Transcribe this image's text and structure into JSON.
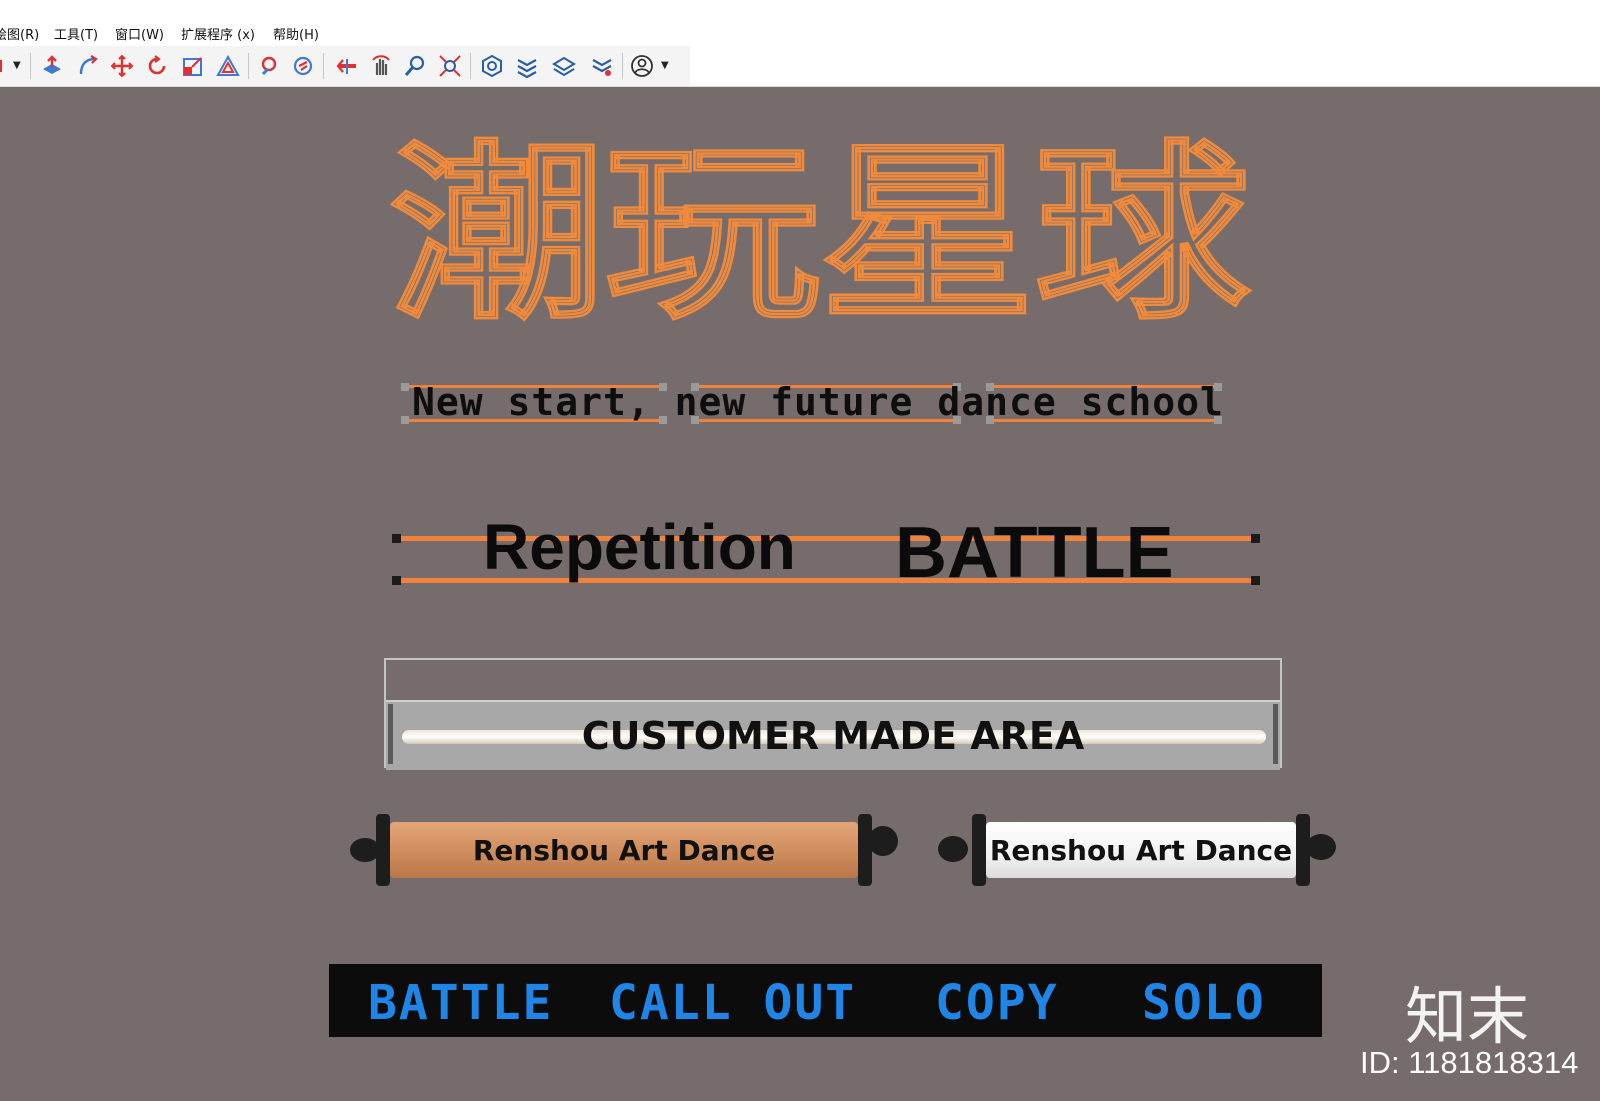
{
  "menu": {
    "items": [
      "绘图(R)",
      "工具(T)",
      "窗口(W)",
      "扩展程序 (x)",
      "帮助(H)"
    ]
  },
  "toolbar": {
    "icons": [
      "select-dropdown-icon",
      "push-pull-icon",
      "follow-me-icon",
      "move-icon",
      "rotate-icon",
      "scale-icon",
      "offset-icon",
      "orbit-icon",
      "pan-3d-icon",
      "position-camera-icon",
      "look-around-icon",
      "zoom-icon",
      "zoom-extents-icon",
      "component-icon",
      "layers-icon",
      "sandbox-icon",
      "styles-icon",
      "account-icon"
    ]
  },
  "canvas": {
    "title_cn": "潮玩星球",
    "subtitle": "New start, new future dance school",
    "repetition": "Repetition",
    "battle": "BATTLE",
    "custom_area": "CUSTOMER MADE AREA",
    "scroll_left": "Renshou Art Dance",
    "scroll_right": "Renshou Art Dance",
    "bar_words": [
      "BATTLE",
      "CALL OUT",
      "COPY",
      "SOLO"
    ]
  },
  "watermark": {
    "logo": "知末",
    "id": "ID: 1181818314"
  },
  "colors": {
    "neon_orange": "#f08a3c",
    "canvas_bg": "#766c6b",
    "blue_text": "#1f86e8",
    "scroll_orange": "#d08f60"
  }
}
